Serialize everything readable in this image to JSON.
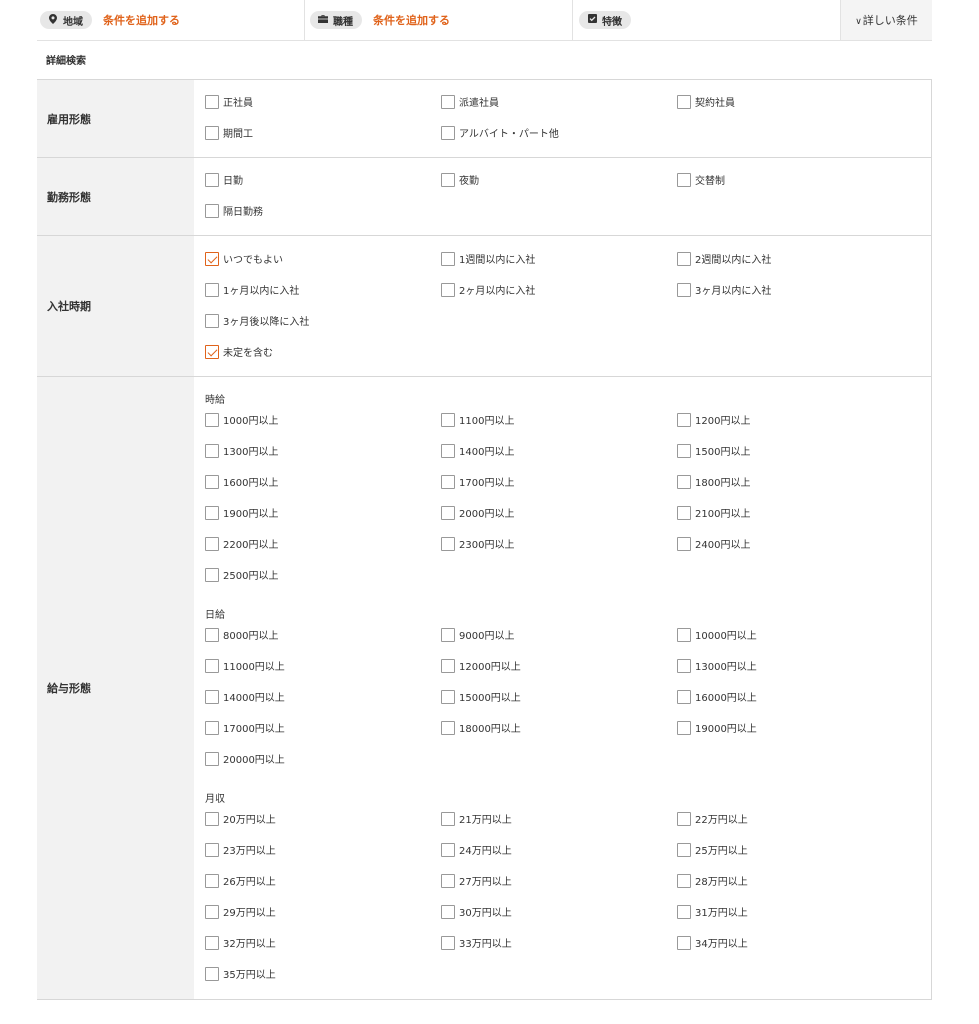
{
  "search_bar": {
    "region_pill": "地域",
    "region_icon": "map-pin-icon",
    "region_add": "条件を追加する",
    "job_pill": "職種",
    "job_icon": "briefcase-icon",
    "job_add": "条件を追加する",
    "feature_pill": "特徴",
    "feature_icon": "checkbox-icon",
    "more_label": "詳しい条件"
  },
  "detail_title": "詳細検索",
  "accent_color": "#e0631b",
  "rows": {
    "employment": {
      "label": "雇用形態",
      "options": [
        {
          "label": "正社員",
          "checked": false
        },
        {
          "label": "派遣社員",
          "checked": false
        },
        {
          "label": "契約社員",
          "checked": false
        },
        {
          "label": "期間工",
          "checked": false
        },
        {
          "label": "アルバイト・パート他",
          "checked": false
        }
      ]
    },
    "work_style": {
      "label": "勤務形態",
      "options": [
        {
          "label": "日勤",
          "checked": false
        },
        {
          "label": "夜勤",
          "checked": false
        },
        {
          "label": "交替制",
          "checked": false
        },
        {
          "label": "隔日勤務",
          "checked": false
        }
      ]
    },
    "start_time": {
      "label": "入社時期",
      "options": [
        {
          "label": "いつでもよい",
          "checked": true
        },
        {
          "label": "1週間以内に入社",
          "checked": false
        },
        {
          "label": "2週間以内に入社",
          "checked": false
        },
        {
          "label": "1ヶ月以内に入社",
          "checked": false
        },
        {
          "label": "2ヶ月以内に入社",
          "checked": false
        },
        {
          "label": "3ヶ月以内に入社",
          "checked": false
        },
        {
          "label": "3ヶ月後以降に入社",
          "checked": false
        }
      ],
      "extra_options": [
        {
          "label": "未定を含む",
          "checked": true
        }
      ]
    },
    "salary": {
      "label": "給与形態",
      "groups": [
        {
          "label": "時給",
          "options": [
            {
              "label": "1000円以上",
              "checked": false
            },
            {
              "label": "1100円以上",
              "checked": false
            },
            {
              "label": "1200円以上",
              "checked": false
            },
            {
              "label": "1300円以上",
              "checked": false
            },
            {
              "label": "1400円以上",
              "checked": false
            },
            {
              "label": "1500円以上",
              "checked": false
            },
            {
              "label": "1600円以上",
              "checked": false
            },
            {
              "label": "1700円以上",
              "checked": false
            },
            {
              "label": "1800円以上",
              "checked": false
            },
            {
              "label": "1900円以上",
              "checked": false
            },
            {
              "label": "2000円以上",
              "checked": false
            },
            {
              "label": "2100円以上",
              "checked": false
            },
            {
              "label": "2200円以上",
              "checked": false
            },
            {
              "label": "2300円以上",
              "checked": false
            },
            {
              "label": "2400円以上",
              "checked": false
            },
            {
              "label": "2500円以上",
              "checked": false
            }
          ]
        },
        {
          "label": "日給",
          "options": [
            {
              "label": "8000円以上",
              "checked": false
            },
            {
              "label": "9000円以上",
              "checked": false
            },
            {
              "label": "10000円以上",
              "checked": false
            },
            {
              "label": "11000円以上",
              "checked": false
            },
            {
              "label": "12000円以上",
              "checked": false
            },
            {
              "label": "13000円以上",
              "checked": false
            },
            {
              "label": "14000円以上",
              "checked": false
            },
            {
              "label": "15000円以上",
              "checked": false
            },
            {
              "label": "16000円以上",
              "checked": false
            },
            {
              "label": "17000円以上",
              "checked": false
            },
            {
              "label": "18000円以上",
              "checked": false
            },
            {
              "label": "19000円以上",
              "checked": false
            },
            {
              "label": "20000円以上",
              "checked": false
            }
          ]
        },
        {
          "label": "月収",
          "options": [
            {
              "label": "20万円以上",
              "checked": false
            },
            {
              "label": "21万円以上",
              "checked": false
            },
            {
              "label": "22万円以上",
              "checked": false
            },
            {
              "label": "23万円以上",
              "checked": false
            },
            {
              "label": "24万円以上",
              "checked": false
            },
            {
              "label": "25万円以上",
              "checked": false
            },
            {
              "label": "26万円以上",
              "checked": false
            },
            {
              "label": "27万円以上",
              "checked": false
            },
            {
              "label": "28万円以上",
              "checked": false
            },
            {
              "label": "29万円以上",
              "checked": false
            },
            {
              "label": "30万円以上",
              "checked": false
            },
            {
              "label": "31万円以上",
              "checked": false
            },
            {
              "label": "32万円以上",
              "checked": false
            },
            {
              "label": "33万円以上",
              "checked": false
            },
            {
              "label": "34万円以上",
              "checked": false
            },
            {
              "label": "35万円以上",
              "checked": false
            }
          ]
        }
      ]
    }
  }
}
